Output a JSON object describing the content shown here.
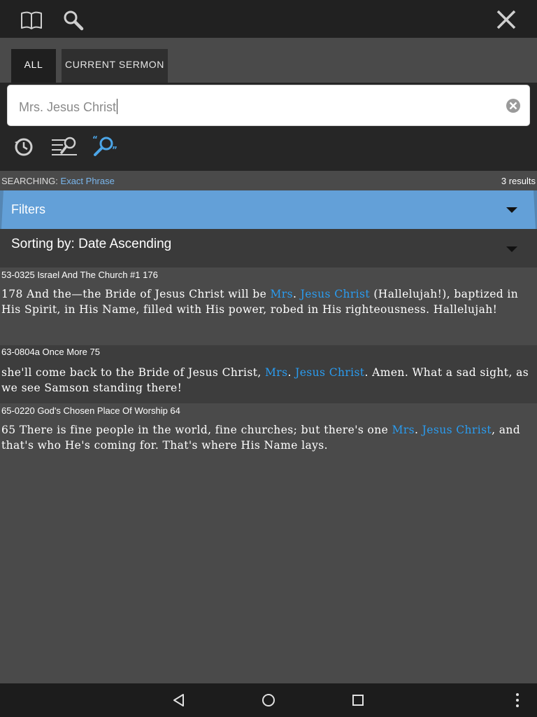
{
  "topbar": {
    "icons": [
      "book-icon",
      "search-icon",
      "close-icon"
    ]
  },
  "tabs": [
    {
      "label": "ALL",
      "active": true
    },
    {
      "label": "CURRENT SERMON",
      "active": false
    }
  ],
  "search": {
    "value": "Mrs. Jesus Christ",
    "tools": [
      "history-icon",
      "filter-lines-icon",
      "exact-phrase-icon"
    ]
  },
  "status": {
    "label": "SEARCHING:",
    "mode": "Exact Phrase",
    "count": "3 results"
  },
  "filters": {
    "label": "Filters"
  },
  "sorting": {
    "label": "Sorting by: Date Ascending"
  },
  "results": [
    {
      "title": "53-0325 Israel And The Church #1 176",
      "pre": "178 And the—the Bride of Jesus Christ will be ",
      "hl1": "Mrs",
      "sep": ". ",
      "hl2": "Jesus Christ",
      "post": " (Hallelujah!), baptized in His Spirit, in His Name, filled with His power, robed in His righteousness. Hallelujah!"
    },
    {
      "title": "63-0804a Once More 75",
      "pre": "she'll come back to the Bride of Jesus Christ, ",
      "hl1": "Mrs",
      "sep": ". ",
      "hl2": "Jesus Christ",
      "post": ". Amen. What a sad sight, as we see Samson standing there!"
    },
    {
      "title": "65-0220 God's Chosen Place Of Worship 64",
      "pre": "65 There is fine people in the world, fine churches; but there's one ",
      "hl1": "Mrs",
      "sep": ". ",
      "hl2": "Jesus Christ",
      "post": ", and that's who He's coming for. That's where His Name lays."
    }
  ],
  "navbar": {
    "icons": [
      "back-icon",
      "home-icon",
      "recents-icon",
      "overflow-menu-icon"
    ]
  },
  "colors": {
    "accent": "#63a0d8",
    "highlight": "#2a9cf0",
    "background": "#4a4a4a"
  }
}
